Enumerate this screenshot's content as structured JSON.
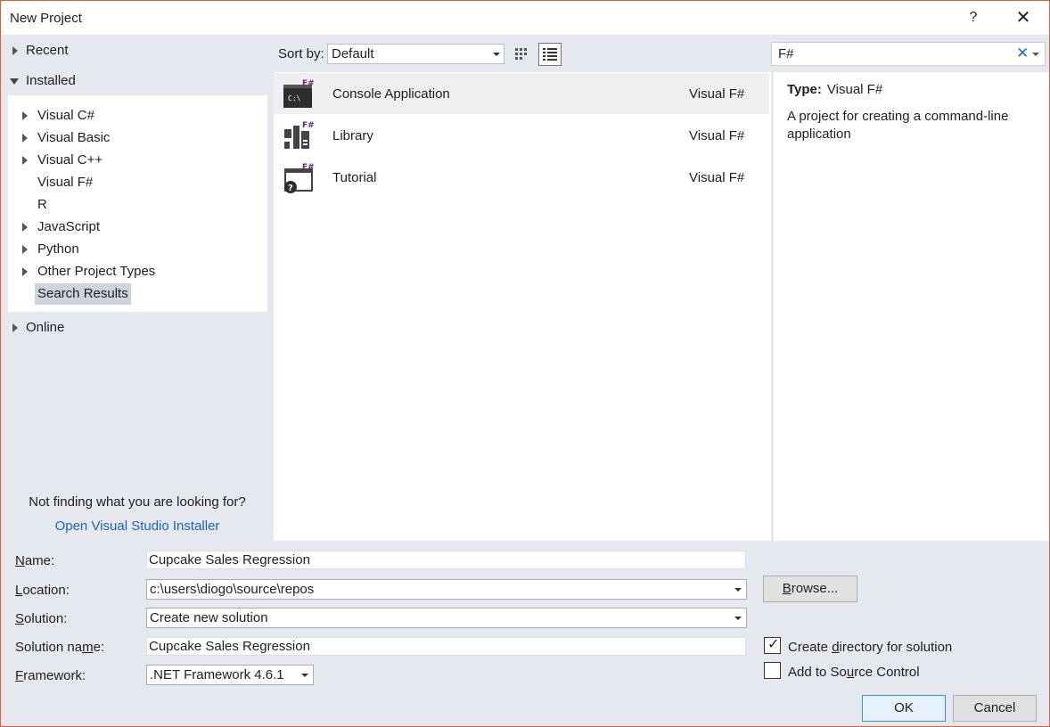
{
  "window": {
    "title": "New Project",
    "help_glyph": "?",
    "close_glyph": "✕"
  },
  "tree": {
    "recent": "Recent",
    "installed": "Installed",
    "installed_items": [
      {
        "label": "Visual C#",
        "expandable": true
      },
      {
        "label": "Visual Basic",
        "expandable": true
      },
      {
        "label": "Visual C++",
        "expandable": true
      },
      {
        "label": "Visual F#",
        "expandable": false
      },
      {
        "label": "R",
        "expandable": false
      },
      {
        "label": "JavaScript",
        "expandable": true
      },
      {
        "label": "Python",
        "expandable": true
      },
      {
        "label": "Other Project Types",
        "expandable": true
      },
      {
        "label": "Search Results",
        "expandable": false,
        "selected": true
      }
    ],
    "online": "Online"
  },
  "hint": {
    "text": "Not finding what you are looking for?",
    "link": "Open Visual Studio Installer"
  },
  "toolbar": {
    "sort_label": "Sort by:",
    "sort_value": "Default"
  },
  "search": {
    "value": "F#",
    "clear_glyph": "✕"
  },
  "templates": [
    {
      "name": "Console Application",
      "language": "Visual F#",
      "icon": "console-app-icon",
      "selected": true
    },
    {
      "name": "Library",
      "language": "Visual F#",
      "icon": "library-icon",
      "selected": false
    },
    {
      "name": "Tutorial",
      "language": "Visual F#",
      "icon": "tutorial-icon",
      "selected": false
    }
  ],
  "details": {
    "type_label": "Type:",
    "type_value": "Visual F#",
    "description": "A project for creating a command-line application"
  },
  "form": {
    "name_label_key": "N",
    "name_label_rest": "ame:",
    "name_value": "Cupcake Sales Regression",
    "location_label_key": "L",
    "location_label_rest": "ocation:",
    "location_value": "c:\\users\\diogo\\source\\repos",
    "solution_label_key": "S",
    "solution_label_rest": "olution:",
    "solution_value": "Create new solution",
    "solution_name_label_pre": "Solution na",
    "solution_name_label_key": "m",
    "solution_name_label_post": "e:",
    "solution_name_value": "Cupcake Sales Regression",
    "framework_label_key": "F",
    "framework_label_rest": "ramework:",
    "framework_value": ".NET Framework 4.6.1",
    "browse_pre": "",
    "browse_key": "B",
    "browse_post": "rowse...",
    "create_dir_pre": "Create ",
    "create_dir_key": "d",
    "create_dir_post": "irectory for solution",
    "create_dir_checked": true,
    "source_control_pre": "Add to So",
    "source_control_key": "u",
    "source_control_post": "rce Control",
    "source_control_checked": false,
    "ok_label": "OK",
    "cancel_label": "Cancel"
  },
  "colors": {
    "accent": "#1e6fd0",
    "fsharp_purple": "#68217a",
    "link": "#1c62b9",
    "panel_bg": "#e6e8ef"
  }
}
